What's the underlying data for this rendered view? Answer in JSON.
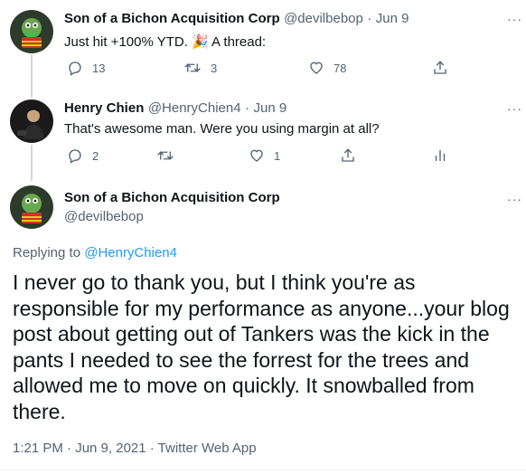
{
  "tweets": [
    {
      "name": "Son of a Bichon Acquisition Corp",
      "handle": "@devilbebop",
      "date": "Jun 9",
      "text": "Just hit +100% YTD. 🎉 A thread:",
      "replies": "13",
      "retweets": "3",
      "likes": "78"
    },
    {
      "name": "Henry Chien",
      "handle": "@HenryChien4",
      "date": "Jun 9",
      "text": "That's awesome man. Were you using margin at all?",
      "replies": "2",
      "retweets": "",
      "likes": "1"
    }
  ],
  "main_tweet": {
    "name": "Son of a Bichon Acquisition Corp",
    "handle": "@devilbebop",
    "replying_prefix": "Replying to",
    "replying_handle": "@HenryChien4",
    "text": "I never go to thank you, but I think you're as responsible for my performance as anyone...your blog post about getting out of Tankers was the kick in the pants I needed to see the forrest for the trees and allowed me to move on quickly. It snowballed from there.",
    "timestamp": "1:21 PM · Jun 9, 2021 · Twitter Web App"
  },
  "separator": "·",
  "more_label": "···",
  "colors": {
    "accent": "#1d9bf0",
    "muted": "#536471",
    "text": "#0f1419"
  }
}
